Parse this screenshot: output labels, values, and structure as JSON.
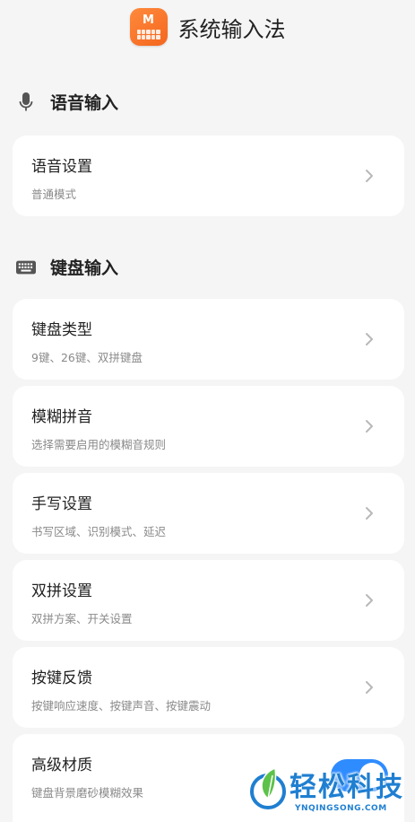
{
  "header": {
    "logo_text": "M",
    "title": "系统输入法"
  },
  "sections": {
    "voice": {
      "title": "语音输入",
      "icon": "microphone-icon"
    },
    "keyboard": {
      "title": "键盘输入",
      "icon": "keyboard-icon"
    }
  },
  "cards": [
    {
      "label": "语音设置",
      "desc": "普通模式"
    },
    {
      "label": "键盘类型",
      "desc": "9键、26键、双拼键盘"
    },
    {
      "label": "模糊拼音",
      "desc": "选择需要启用的模糊音规则"
    },
    {
      "label": "手写设置",
      "desc": "书写区域、识别模式、延迟"
    },
    {
      "label": "双拼设置",
      "desc": "双拼方案、开关设置"
    },
    {
      "label": "按键反馈",
      "desc": "按键响应速度、按键声音、按键震动"
    },
    {
      "label": "高级材质",
      "desc": "键盘背景磨砂模糊效果",
      "toggle_on": true
    }
  ],
  "colors": {
    "accent": "#2f8cff",
    "logo": "#f4661e",
    "background": "#f5f5f5",
    "card": "#ffffff"
  },
  "watermark": {
    "text": "轻松科技",
    "sub": "YNQINGSONG.COM"
  }
}
